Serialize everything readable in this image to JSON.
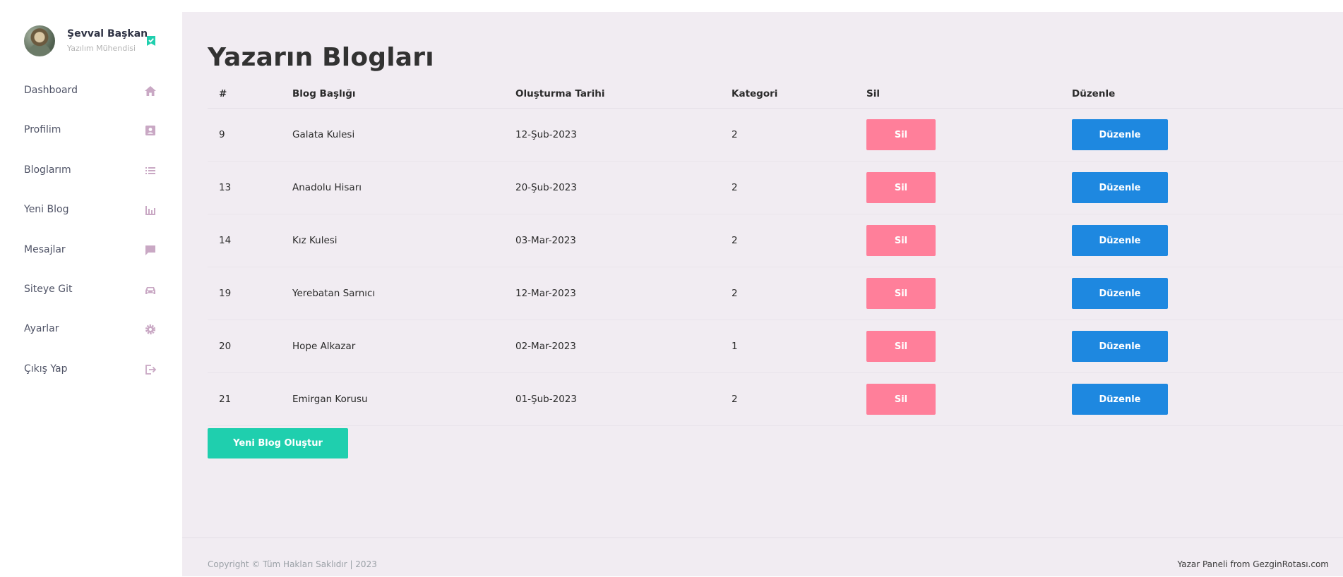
{
  "colors": {
    "sidebar_icon": "#c9a8c4",
    "verified": "#1fcfae",
    "delete_button": "#ff7f9a",
    "edit_button": "#1e88e0",
    "new_button": "#1fcfae",
    "main_background": "#f1ecf2"
  },
  "profile": {
    "name": "Şevval Başkan",
    "role": "Yazılım Mühendisi",
    "badge_icon": "verified-badge-icon"
  },
  "sidebar": {
    "items": [
      {
        "label": "Dashboard",
        "icon": "home-icon"
      },
      {
        "label": "Profilim",
        "icon": "contact-card-icon"
      },
      {
        "label": "Bloglarım",
        "icon": "list-icon"
      },
      {
        "label": "Yeni Blog",
        "icon": "bar-chart-icon"
      },
      {
        "label": "Mesajlar",
        "icon": "chat-icon"
      },
      {
        "label": "Siteye Git",
        "icon": "car-icon"
      },
      {
        "label": "Ayarlar",
        "icon": "gear-icon"
      },
      {
        "label": "Çıkış Yap",
        "icon": "logout-icon"
      }
    ]
  },
  "main": {
    "title": "Yazarın Blogları",
    "table": {
      "headers": [
        "#",
        "Blog Başlığı",
        "Oluşturma Tarihi",
        "Kategori",
        "Sil",
        "Düzenle"
      ],
      "rows": [
        {
          "id": "9",
          "title": "Galata Kulesi",
          "date": "12-Şub-2023",
          "category": "2",
          "delete": "Sil",
          "edit": "Düzenle"
        },
        {
          "id": "13",
          "title": "Anadolu Hisarı",
          "date": "20-Şub-2023",
          "category": "2",
          "delete": "Sil",
          "edit": "Düzenle"
        },
        {
          "id": "14",
          "title": "Kız Kulesi",
          "date": "03-Mar-2023",
          "category": "2",
          "delete": "Sil",
          "edit": "Düzenle"
        },
        {
          "id": "19",
          "title": "Yerebatan Sarnıcı",
          "date": "12-Mar-2023",
          "category": "2",
          "delete": "Sil",
          "edit": "Düzenle"
        },
        {
          "id": "20",
          "title": "Hope Alkazar",
          "date": "02-Mar-2023",
          "category": "1",
          "delete": "Sil",
          "edit": "Düzenle"
        },
        {
          "id": "21",
          "title": "Emirgan Korusu",
          "date": "01-Şub-2023",
          "category": "2",
          "delete": "Sil",
          "edit": "Düzenle"
        }
      ]
    },
    "new_blog_button": "Yeni Blog Oluştur"
  },
  "footer": {
    "copyright": "Copyright © Tüm Hakları Saklıdır | 2023",
    "credit": "Yazar Paneli from GezginRotası.com"
  }
}
